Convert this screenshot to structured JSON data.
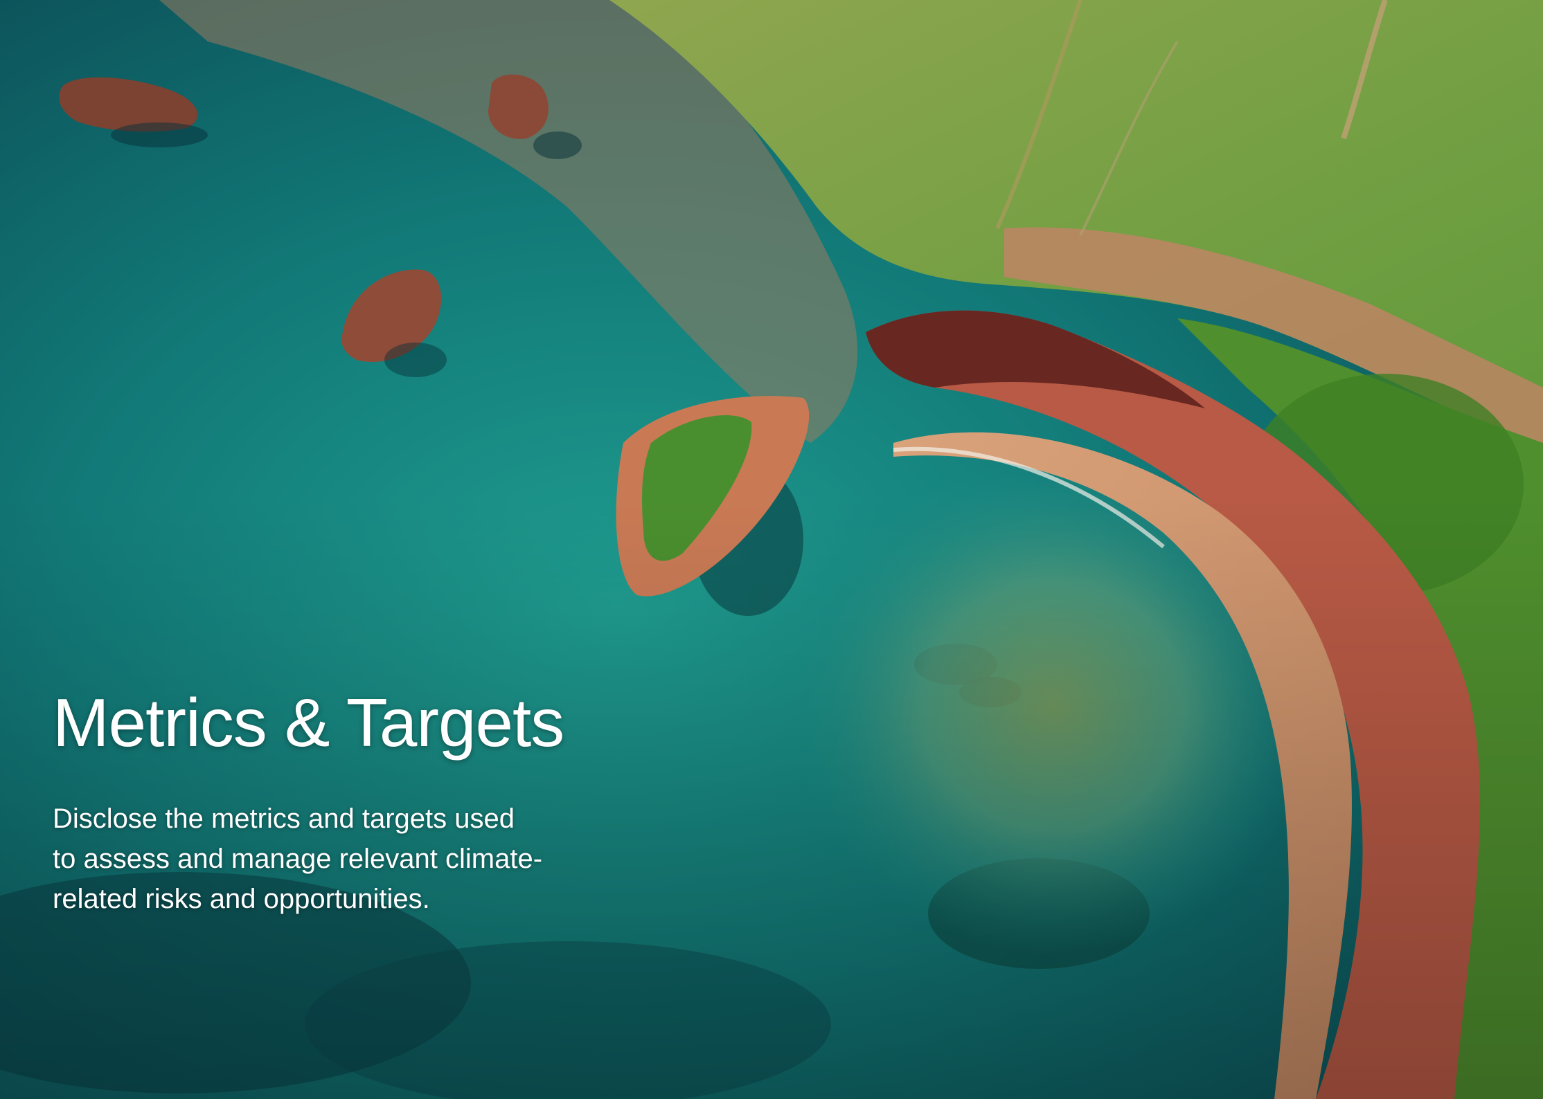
{
  "title": "Metrics & Targets",
  "description_lines": [
    "Disclose the metrics and targets used",
    "to assess and manage relevant climate-",
    "related risks and opportunities."
  ]
}
